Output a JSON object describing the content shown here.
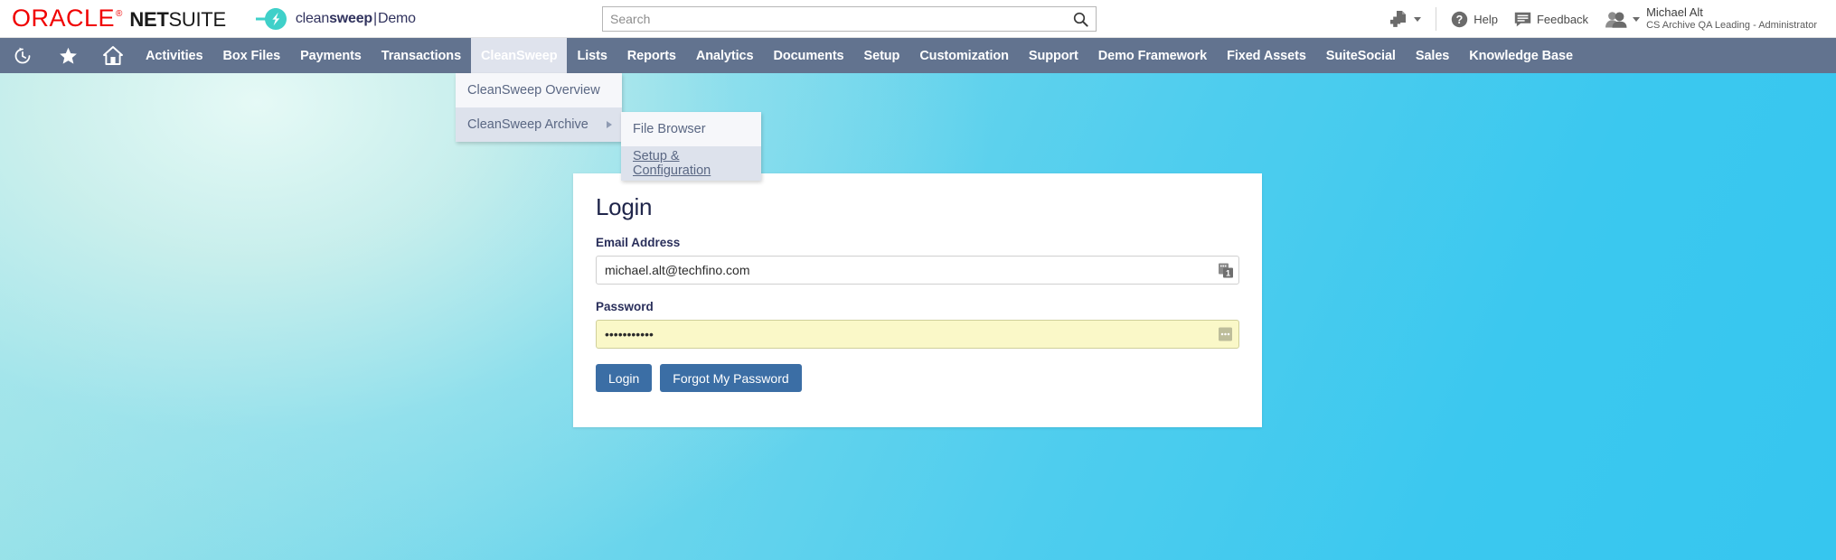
{
  "header": {
    "brand": {
      "oracle": "ORACLE",
      "oracle_reg": "®",
      "netsuite_bold": "NET",
      "netsuite_light": "SUITE"
    },
    "app_logo": {
      "icon": "cleansweep-logo-icon",
      "text_light": "clean",
      "text_bold": "sweep",
      "separator": "|",
      "text_suffix": "Demo"
    },
    "search": {
      "placeholder": "Search",
      "value": "",
      "icon": "search-icon"
    },
    "create_new": {
      "icon": "create-new-icon",
      "label": ""
    },
    "help": {
      "icon": "help-circle-icon",
      "label": "Help"
    },
    "feedback": {
      "icon": "feedback-icon",
      "label": "Feedback"
    },
    "user": {
      "icon": "user-avatar-icon",
      "name": "Michael Alt",
      "role": "CS Archive QA Leading - Administrator"
    }
  },
  "nav": {
    "icons": [
      {
        "name": "recent-records-icon",
        "title": "Recent Records"
      },
      {
        "name": "shortcuts-star-icon",
        "title": "Shortcuts"
      },
      {
        "name": "home-icon",
        "title": "Home"
      }
    ],
    "items": [
      {
        "label": "Activities",
        "active": false
      },
      {
        "label": "Box Files",
        "active": false
      },
      {
        "label": "Payments",
        "active": false
      },
      {
        "label": "Transactions",
        "active": false
      },
      {
        "label": "CleanSweep",
        "active": true
      },
      {
        "label": "Lists",
        "active": false
      },
      {
        "label": "Reports",
        "active": false
      },
      {
        "label": "Analytics",
        "active": false
      },
      {
        "label": "Documents",
        "active": false
      },
      {
        "label": "Setup",
        "active": false
      },
      {
        "label": "Customization",
        "active": false
      },
      {
        "label": "Support",
        "active": false
      },
      {
        "label": "Demo Framework",
        "active": false
      },
      {
        "label": "Fixed Assets",
        "active": false
      },
      {
        "label": "SuiteSocial",
        "active": false
      },
      {
        "label": "Sales",
        "active": false
      },
      {
        "label": "Knowledge Base",
        "active": false
      }
    ]
  },
  "dropdown": {
    "items": [
      {
        "label": "CleanSweep Overview",
        "hovered": false,
        "has_submenu": false
      },
      {
        "label": "CleanSweep Archive",
        "hovered": true,
        "has_submenu": true
      }
    ],
    "submenu": {
      "items": [
        {
          "label": "File Browser",
          "hovered": false,
          "underlined": false
        },
        {
          "label": "Setup & Configuration",
          "hovered": true,
          "underlined": true
        }
      ]
    }
  },
  "login": {
    "title": "Login",
    "email": {
      "label": "Email Address",
      "value": "michael.alt@techfino.com",
      "placeholder": "",
      "icon": "password-manager-icon"
    },
    "password": {
      "label": "Password",
      "value": "•••••••••••",
      "placeholder": "",
      "icon": "password-manager-icon"
    },
    "login_button": "Login",
    "forgot_button": "Forgot My Password"
  },
  "colors": {
    "oracle_red": "#f00000",
    "navbar_blue": "#62738f",
    "nav_active_bg": "#dfe3ed",
    "button_blue": "#3b6ea5",
    "autofill_yellow": "#faf8c8",
    "cleansweep_teal": "#3fd0c9",
    "background_cyan": "#3bc8ef",
    "background_mint": "#d1f1ed",
    "menu_bg": "#f6f7fa",
    "menu_hover_bg": "#dde2ec",
    "menu_text": "#5a6783"
  }
}
